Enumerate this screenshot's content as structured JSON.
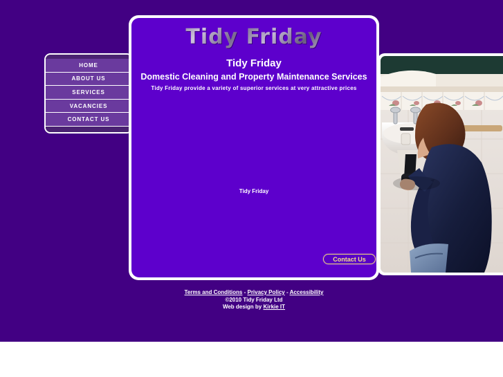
{
  "colors": {
    "page_background": "#420083",
    "panel_background": "#5d00cc",
    "nav_item": "#6a3a9e",
    "nav_frame": "#4a2272",
    "panel_border": "#ffffff",
    "button_accent": "#f4e08a",
    "text": "#ffffff",
    "below_fold": "#ffffff"
  },
  "site": {
    "logo_text": "Tidy Friday"
  },
  "nav": {
    "items": [
      {
        "label": "HOME"
      },
      {
        "label": "ABOUT US"
      },
      {
        "label": "SERVICES"
      },
      {
        "label": "VACANCIES"
      },
      {
        "label": "CONTACT US"
      }
    ]
  },
  "main": {
    "headline": "Tidy Friday",
    "subheadline": "Domestic Cleaning and Property Maintenance Services",
    "tagline": "Tidy Friday provide a variety of superior services at very attractive prices",
    "body_note": "Tidy Friday",
    "contact_button": "Contact Us"
  },
  "photo": {
    "alt": "Tradesman working under a bathroom sink"
  },
  "footer": {
    "links": [
      {
        "label": "Terms and Conditions"
      },
      {
        "label": "Privacy Policy"
      },
      {
        "label": "Accessibility"
      }
    ],
    "separator": " - ",
    "copyright": "©2010 Tidy Friday Ltd",
    "credit_prefix": "Web design by ",
    "credit_link": "Kirkie IT"
  }
}
